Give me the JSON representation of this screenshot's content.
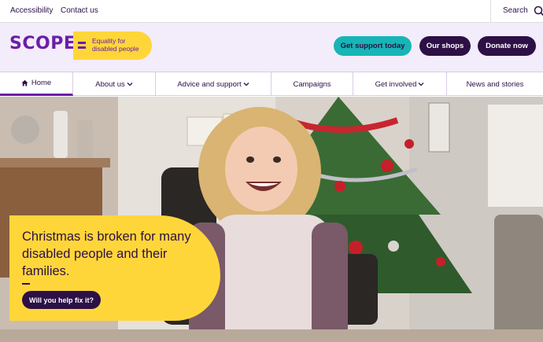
{
  "utility": {
    "accessibility_label": "Accessibility",
    "contact_label": "Contact us",
    "search_label": "Search",
    "search_icon": "search-icon"
  },
  "brand": {
    "logo_word": "SCOPE",
    "tagline": "Equality for disabled people",
    "colors": {
      "purple": "#6b1ea8",
      "dark": "#2d1046",
      "yellow": "#ffd63a",
      "teal": "#17b5b6"
    }
  },
  "actions": {
    "support": "Get support today",
    "shops": "Our shops",
    "donate": "Donate now"
  },
  "nav": {
    "items": [
      {
        "label": "Home",
        "icon": "home-icon",
        "active": true
      },
      {
        "label": "About us",
        "dropdown": true
      },
      {
        "label": "Advice and support",
        "dropdown": true
      },
      {
        "label": "Campaigns"
      },
      {
        "label": "Get involved",
        "dropdown": true
      },
      {
        "label": "News and stories"
      }
    ]
  },
  "hero": {
    "headline": "Christmas is broken for many disabled people and their families.",
    "cta": "Will you help fix it?"
  }
}
